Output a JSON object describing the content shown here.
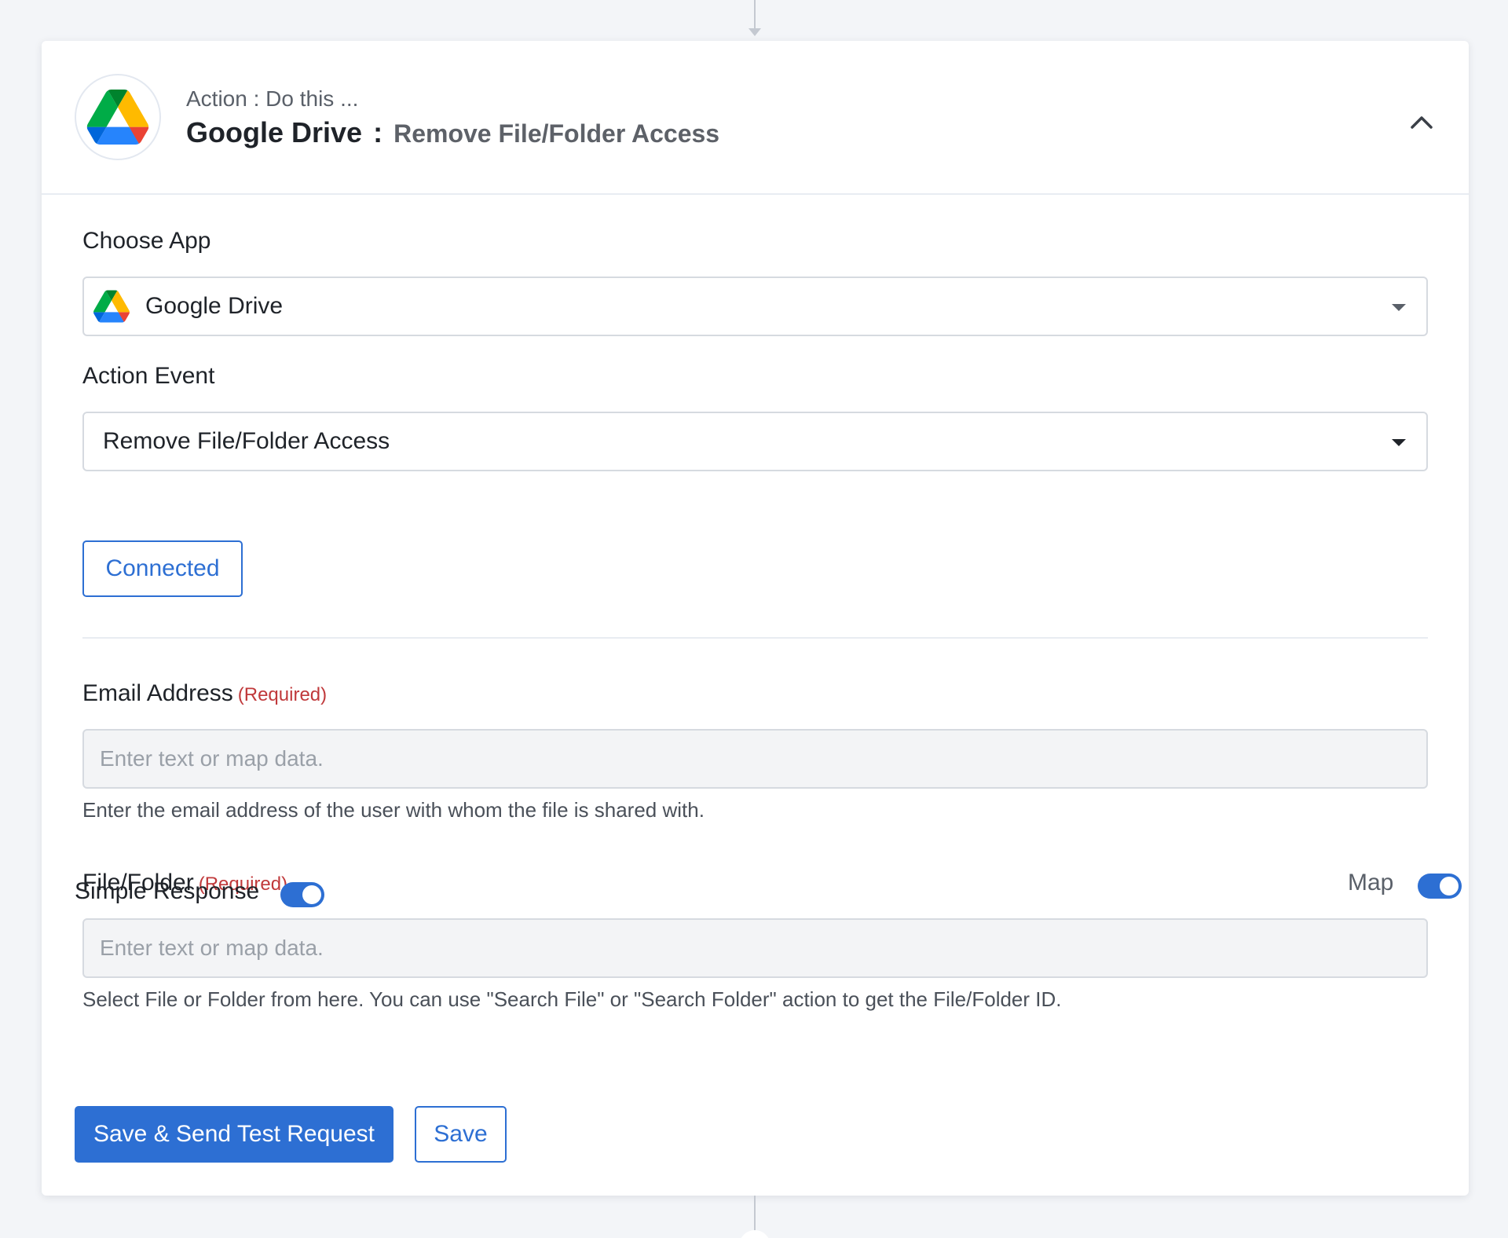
{
  "header": {
    "subtitle": "Action : Do this ...",
    "app_name": "Google Drive",
    "separator": ":",
    "event_name": "Remove File/Folder Access"
  },
  "choose_app": {
    "label": "Choose App",
    "value": "Google Drive",
    "icon": "google-drive-icon"
  },
  "action_event": {
    "label": "Action Event",
    "value": "Remove File/Folder Access"
  },
  "connection": {
    "status_label": "Connected"
  },
  "email_field": {
    "label": "Email Address",
    "required": "(Required)",
    "placeholder": "Enter text or map data.",
    "value": "",
    "help": "Enter the email address of the user with whom the file is shared with."
  },
  "file_field": {
    "label": "File/Folder",
    "required": "(Required)",
    "map_label": "Map",
    "map_enabled": true,
    "placeholder": "Enter text or map data.",
    "value": "",
    "help": "Select File or Folder from here. You can use \"Search File\" or \"Search Folder\" action to get the File/Folder ID."
  },
  "simple_response": {
    "label": "Simple Response",
    "enabled": true
  },
  "buttons": {
    "save_and_test": "Save & Send Test Request",
    "save": "Save"
  },
  "colors": {
    "accent": "#2d6fd3",
    "required": "#c0393b",
    "background": "#f3f5f8",
    "drive_green": "#1fa463",
    "drive_yellow": "#ffd04b",
    "drive_blue": "#4688f4"
  }
}
